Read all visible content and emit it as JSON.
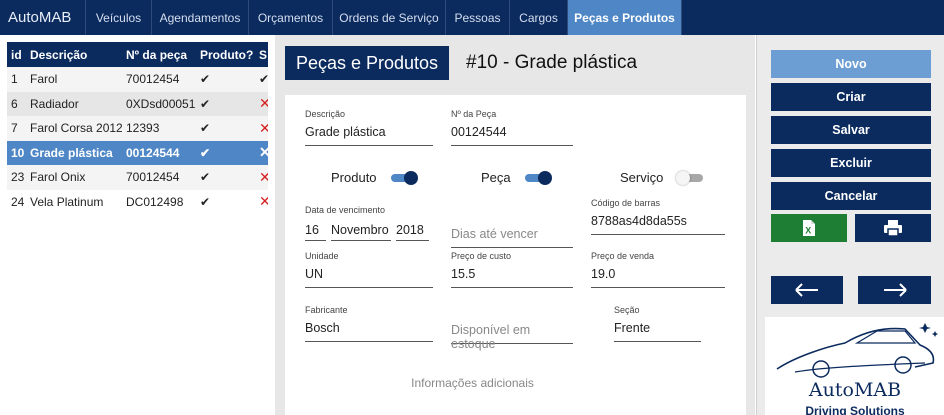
{
  "app": {
    "name": "AutoMAB"
  },
  "nav": {
    "items": [
      {
        "label": "Veículos"
      },
      {
        "label": "Agendamentos"
      },
      {
        "label": "Orçamentos"
      },
      {
        "label": "Ordens de Serviço"
      },
      {
        "label": "Pessoas"
      },
      {
        "label": "Cargos"
      },
      {
        "label": "Peças e Produtos",
        "active": true
      }
    ]
  },
  "table": {
    "headers": [
      "id",
      "Descrição",
      "Nº da peça",
      "Produto?",
      "S"
    ],
    "rows": [
      {
        "id": "1",
        "descricao": "Farol",
        "numero": "70012454",
        "produto": "✔",
        "servico": "✔"
      },
      {
        "id": "6",
        "descricao": "Radiador",
        "numero": "0XDsd00051",
        "produto": "✔",
        "servico": "✕"
      },
      {
        "id": "7",
        "descricao": "Farol Corsa 2012",
        "numero": "12393",
        "produto": "✔",
        "servico": "✕"
      },
      {
        "id": "10",
        "descricao": "Grade plástica",
        "numero": "00124544",
        "produto": "✔",
        "servico": "✕",
        "selected": true
      },
      {
        "id": "23",
        "descricao": "Farol Onix",
        "numero": "70012454",
        "produto": "✔",
        "servico": "✕"
      },
      {
        "id": "24",
        "descricao": "Vela Platinum",
        "numero": "DC012498",
        "produto": "✔",
        "servico": "✕"
      }
    ]
  },
  "section": {
    "title": "Peças e Produtos",
    "record_title": "#10 - Grade plástica"
  },
  "form": {
    "descricao": {
      "label": "Descrição",
      "value": "Grade plástica"
    },
    "numero": {
      "label": "Nº da Peça",
      "value": "00124544"
    },
    "toggles": {
      "produto": {
        "label": "Produto",
        "on": true
      },
      "peca": {
        "label": "Peça",
        "on": true
      },
      "servico": {
        "label": "Serviço",
        "on": false
      }
    },
    "vencimento": {
      "label": "Data de vencimento",
      "day": "16",
      "month": "Novembro",
      "year": "2018"
    },
    "dias": {
      "placeholder": "Dias até vencer"
    },
    "codigo": {
      "label": "Código de barras",
      "value": "8788as4d8da55s"
    },
    "unidade": {
      "label": "Unidade",
      "value": "UN"
    },
    "custo": {
      "label": "Preço de custo",
      "value": "15.5"
    },
    "venda": {
      "label": "Preço de venda",
      "value": "19.0"
    },
    "fabricante": {
      "label": "Fabricante",
      "value": "Bosch"
    },
    "estoque": {
      "placeholder": "Disponível em estoque"
    },
    "secao": {
      "label": "Seção",
      "value": "Frente"
    },
    "extra": {
      "placeholder": "Informações adicionais"
    }
  },
  "actions": {
    "novo": "Novo",
    "criar": "Criar",
    "salvar": "Salvar",
    "excluir": "Excluir",
    "cancelar": "Cancelar",
    "excel_icon": "excel-export-icon",
    "print_icon": "printer-icon",
    "prev_icon": "arrow-left-icon",
    "next_icon": "arrow-right-icon"
  },
  "logo": {
    "name": "AutoMAB",
    "tagline": "Driving Solutions"
  },
  "colors": {
    "navy": "#0b2a5e",
    "accent": "#4f87c6",
    "light_button": "#6d9ed3",
    "excel_green": "#1e7e34",
    "delete_red": "#d62020"
  }
}
